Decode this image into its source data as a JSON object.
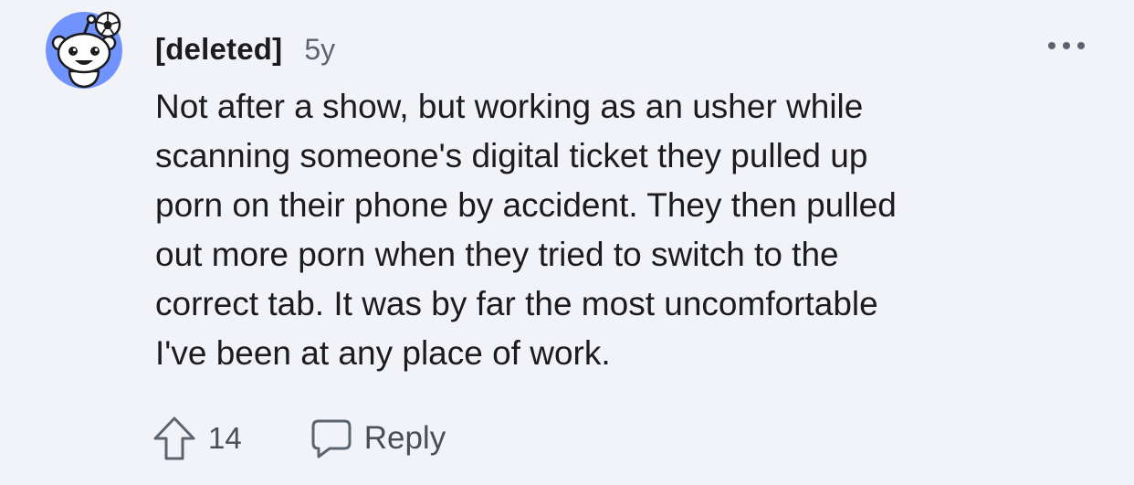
{
  "comment": {
    "avatar_icon": "snoo-avatar-with-soccer-ball-icon",
    "author": "[deleted]",
    "age": "5y",
    "more_icon": "ellipsis-icon",
    "body_lines": [
      "Not after a show, but working as an usher while",
      "scanning someone's digital ticket they pulled up",
      "porn on their phone by accident. They then pulled",
      "out more porn when they tried to switch to the",
      "correct tab. It was by far the most uncomfortable",
      "I've been at any place of work."
    ]
  },
  "actions": {
    "upvote_icon": "upvote-arrow-icon",
    "vote_count": "14",
    "reply_icon": "comment-bubble-icon",
    "reply_label": "Reply"
  },
  "colors": {
    "background": "#f1f3f8",
    "avatar_background": "#7193ff",
    "text_primary": "#1c1c1e",
    "text_secondary": "#5c6470"
  }
}
